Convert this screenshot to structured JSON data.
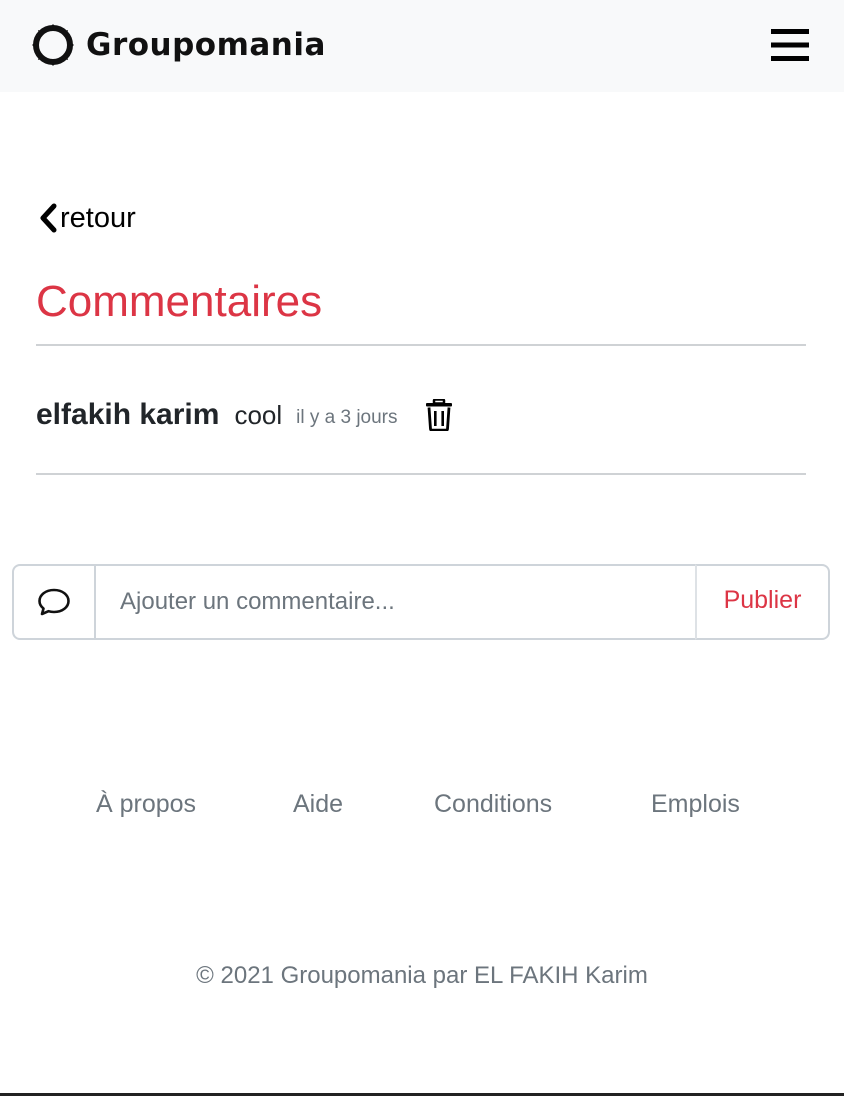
{
  "navbar": {
    "brand_name": "Groupomania",
    "logo_icon": "groupomania-logo-icon",
    "menu_icon": "hamburger-menu-icon"
  },
  "back": {
    "label": "retour",
    "icon": "chevron-left-icon"
  },
  "comments_section": {
    "title": "Commentaires",
    "title_color": "#dc3545",
    "items": [
      {
        "author": "elfakih karim",
        "text": "cool",
        "time": "il y a 3 jours",
        "delete_icon": "trash-icon"
      }
    ]
  },
  "comment_form": {
    "icon": "speech-bubble-icon",
    "placeholder": "Ajouter un commentaire...",
    "value": "",
    "submit_label": "Publier",
    "submit_color": "#dc3545"
  },
  "footer": {
    "links": [
      "À propos",
      "Aide",
      "Conditions",
      "Emplois"
    ],
    "copyright": "© 2021 Groupomania par EL FAKIH Karim"
  },
  "colors": {
    "accent": "#dc3545",
    "navbar_bg": "#f8f9fa",
    "muted_text": "#6c757d"
  }
}
